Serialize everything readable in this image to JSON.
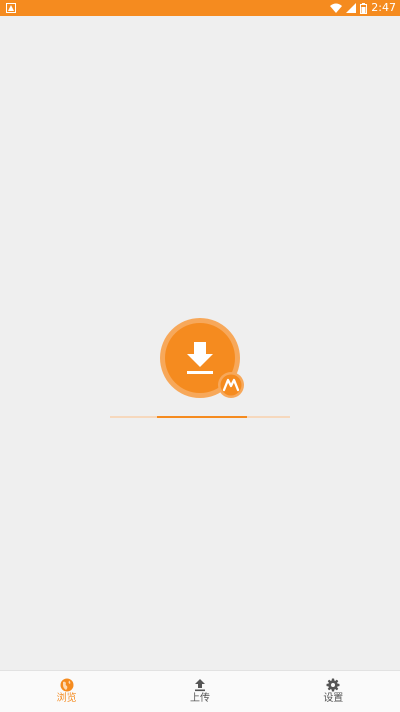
{
  "status_bar": {
    "time": "2:47",
    "background": "#f58b1f",
    "icons": [
      "app-notification-icon",
      "wifi-icon",
      "cell-signal-icon",
      "battery-icon"
    ]
  },
  "loading": {
    "logo_icon": "download-badge-icon",
    "accent": "#f58b1f",
    "progress": 0.5
  },
  "bottom_nav": {
    "items": [
      {
        "label": "浏览",
        "icon": "globe-icon",
        "active": true
      },
      {
        "label": "上传",
        "icon": "upload-icon",
        "active": false
      },
      {
        "label": "设置",
        "icon": "gear-icon",
        "active": false
      }
    ]
  }
}
